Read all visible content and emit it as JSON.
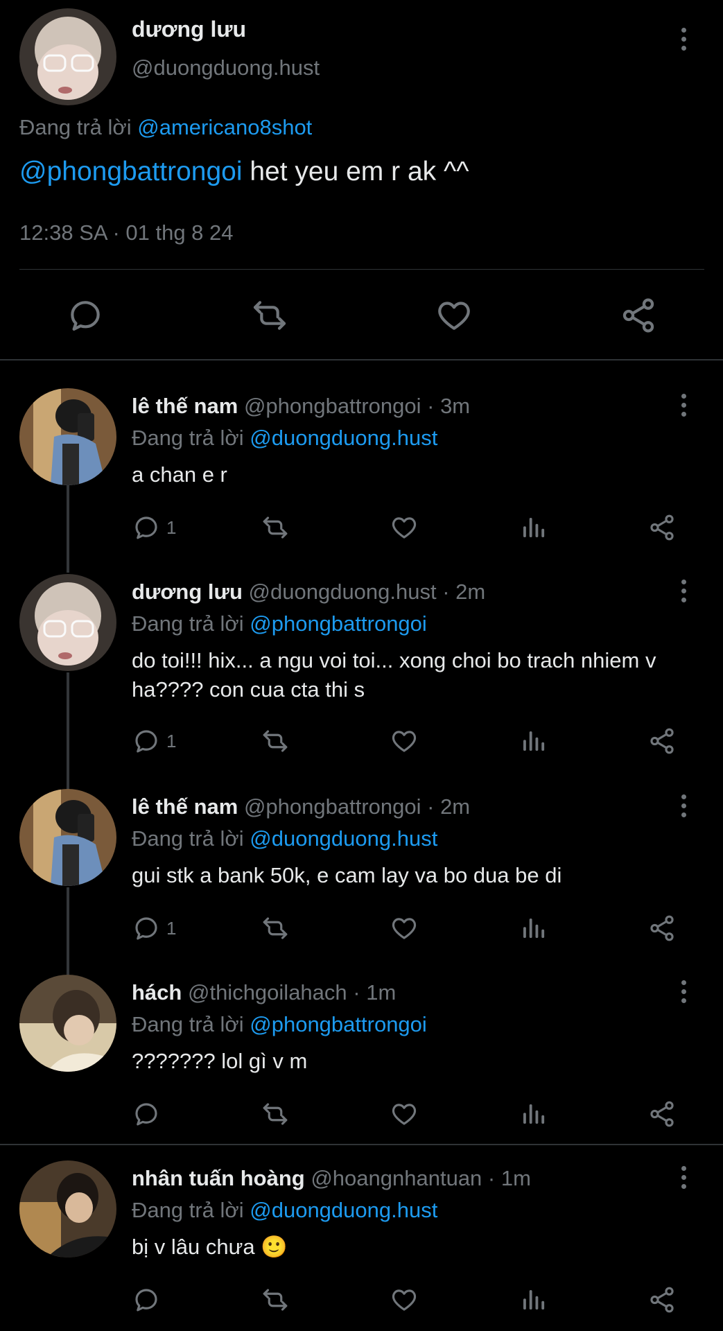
{
  "main_tweet": {
    "name": "dương lưu",
    "handle": "@duongduong.hust",
    "replying_prefix": "Đang trả lời",
    "replying_to": "@americano8shot",
    "mention": "@phongbattrongoi",
    "text": " het yeu em r ak ^^",
    "timestamp": "12:38 SA · 01 thg 8 24"
  },
  "replies": [
    {
      "name": "lê thế nam",
      "handle": "@phongbattrongoi",
      "time": " · 3m",
      "replying_prefix": "Đang trả lời",
      "replying_to": "@duongduong.hust",
      "text": "a chan e r",
      "reply_count": "1"
    },
    {
      "name": "dương lưu",
      "handle": "@duongduong.hust",
      "time": " · 2m",
      "replying_prefix": "Đang trả lời",
      "replying_to": "@phongbattrongoi",
      "text": "do toi!!! hix... a ngu voi toi... xong choi bo trach nhiem v ha???? con cua cta thi s",
      "reply_count": "1"
    },
    {
      "name": "lê thế nam",
      "handle": "@phongbattrongoi",
      "time": " · 2m",
      "replying_prefix": "Đang trả lời",
      "replying_to": "@duongduong.hust",
      "text": "gui stk a bank 50k, e cam lay va bo dua be di",
      "reply_count": "1"
    },
    {
      "name": "hách",
      "handle": "@thichgoilahach",
      "time": " · 1m",
      "replying_prefix": "Đang trả lời",
      "replying_to": "@phongbattrongoi",
      "text": "??????? lol gì v m",
      "reply_count": ""
    },
    {
      "name": "nhân tuấn hoàng",
      "handle": "@hoangnhantuan",
      "time": " · 1m",
      "replying_prefix": "Đang trả lời",
      "replying_to": "@duongduong.hust",
      "text": "bị v lâu chưa 🙂",
      "reply_count": ""
    }
  ],
  "colors": {
    "background": "#000000",
    "text": "#e7e9ea",
    "muted": "#71767b",
    "link": "#1d9bf0",
    "divider": "#2f3336"
  },
  "icons": [
    "reply-icon",
    "retweet-icon",
    "like-icon",
    "views-icon",
    "share-icon",
    "more-icon"
  ]
}
